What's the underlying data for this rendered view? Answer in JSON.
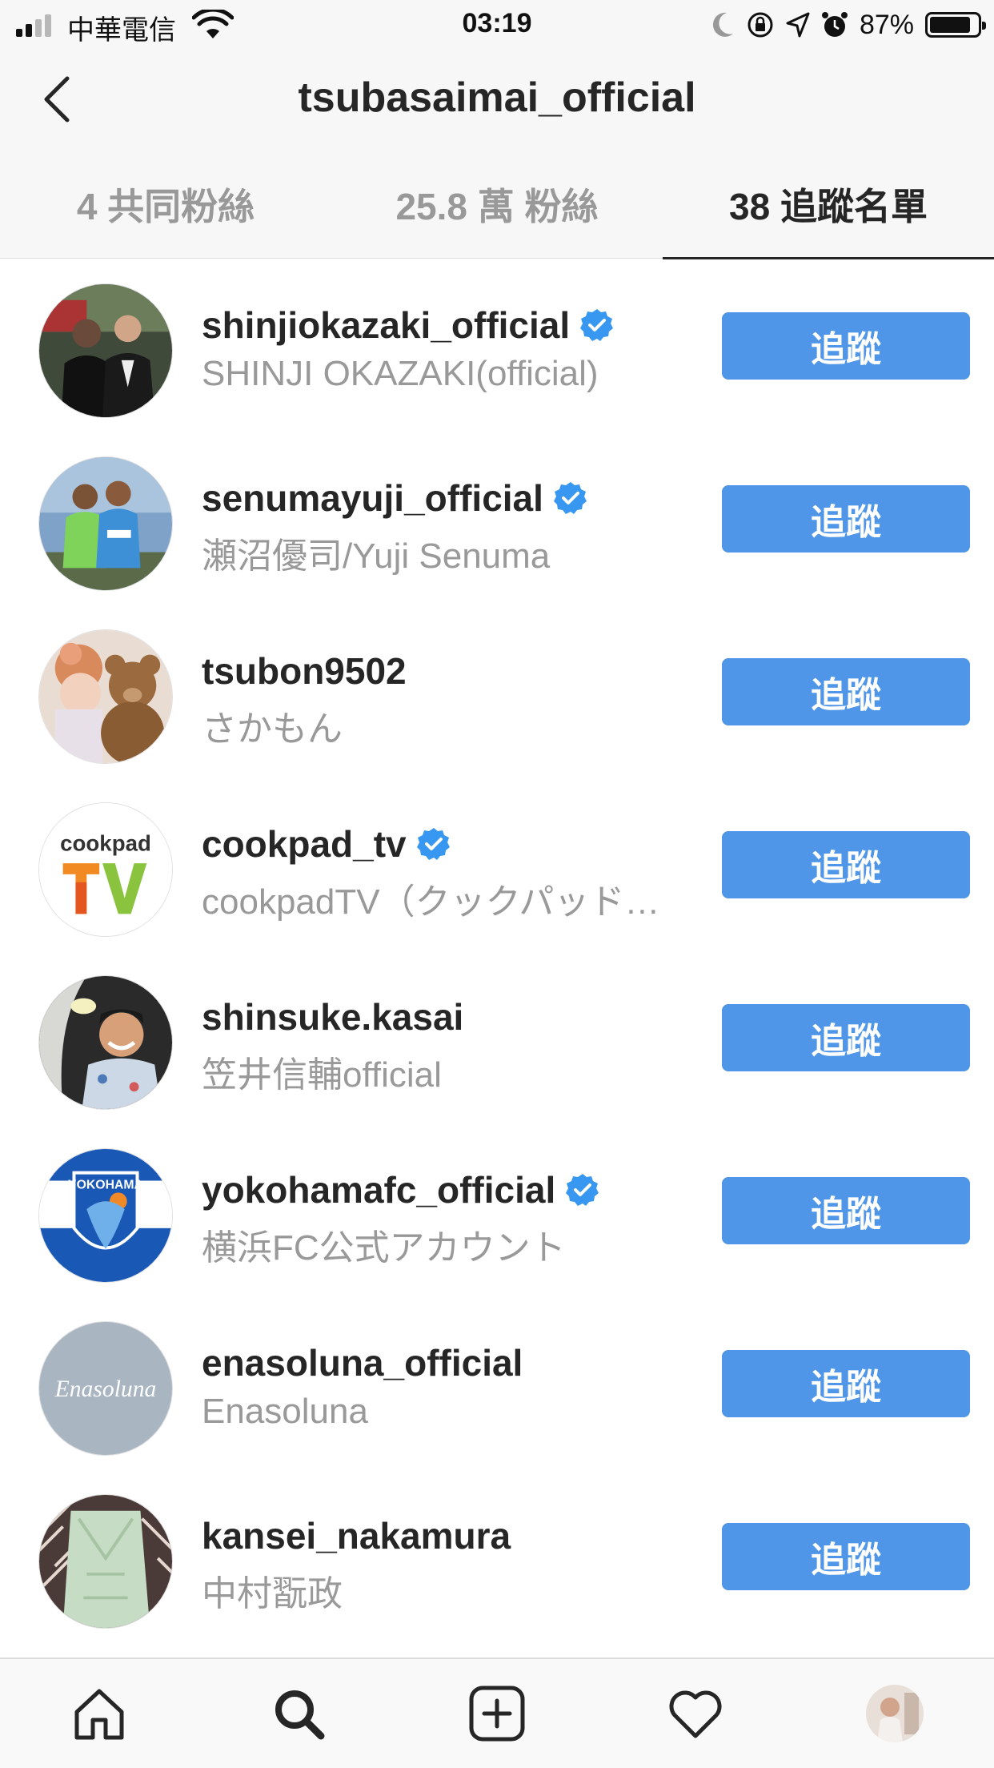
{
  "status_bar": {
    "carrier": "中華電信",
    "time": "03:19",
    "battery_percent": "87%",
    "battery_level": 0.87
  },
  "header": {
    "title": "tsubasaimai_official"
  },
  "tabs": [
    {
      "label": "4 共同粉絲",
      "active": false
    },
    {
      "label": "25.8 萬 粉絲",
      "active": false
    },
    {
      "label": "38 追蹤名單",
      "active": true
    }
  ],
  "users": [
    {
      "username": "shinjiokazaki_official",
      "display_name": "SHINJI OKAZAKI(official)",
      "verified": true,
      "button": "追蹤",
      "avatar": "two-men-photo"
    },
    {
      "username": "senumayuji_official",
      "display_name": "瀬沼優司/Yuji Senuma",
      "verified": true,
      "button": "追蹤",
      "avatar": "soccer-players-photo"
    },
    {
      "username": "tsubon9502",
      "display_name": "さかもん",
      "verified": false,
      "button": "追蹤",
      "avatar": "teddy-bears-photo"
    },
    {
      "username": "cookpad_tv",
      "display_name": "cookpadTV（クックパッド…",
      "verified": true,
      "button": "追蹤",
      "avatar": "cookpad-tv-logo",
      "logo_text": "cookpad",
      "logo_tv": "TV"
    },
    {
      "username": "shinsuke.kasai",
      "display_name": "笠井信輔official",
      "verified": false,
      "button": "追蹤",
      "avatar": "smiling-man-photo"
    },
    {
      "username": "yokohamafc_official",
      "display_name": "横浜FC公式アカウント",
      "verified": true,
      "button": "追蹤",
      "avatar": "yokohama-fc-crest",
      "logo_text": "YOKOHAMA"
    },
    {
      "username": "enasoluna_official",
      "display_name": "Enasoluna",
      "verified": false,
      "button": "追蹤",
      "avatar": "enasoluna-logo",
      "logo_text": "Enasoluna"
    },
    {
      "username": "kansei_nakamura",
      "display_name": "中村翫政",
      "verified": false,
      "button": "追蹤",
      "avatar": "pattern-fabric-photo"
    }
  ],
  "tab_bar": [
    {
      "icon": "home-icon"
    },
    {
      "icon": "search-icon"
    },
    {
      "icon": "add-post-icon"
    },
    {
      "icon": "heart-icon"
    },
    {
      "icon": "profile-avatar"
    }
  ],
  "colors": {
    "follow_button": "#4f95e8",
    "verified": "#3897f0",
    "secondary_text": "#999999",
    "primary_text": "#262626"
  }
}
